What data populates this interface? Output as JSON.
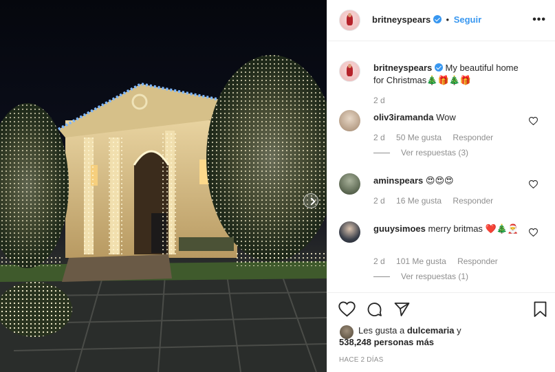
{
  "post": {
    "username": "britneyspears",
    "follow_label": "Seguir",
    "separator": "•",
    "more_label": "•••"
  },
  "caption": {
    "username": "britneyspears",
    "text": "My beautiful home for Christmas",
    "emojis": "🎄🎁🎄🎁",
    "time": "2 d"
  },
  "comments": [
    {
      "username": "oliv3iramanda",
      "text": "Wow",
      "time": "2 d",
      "likes": "50 Me gusta",
      "reply_label": "Responder",
      "view_replies": "Ver respuestas (3)"
    },
    {
      "username": "aminspears",
      "text": "😍😍😍",
      "time": "2 d",
      "likes": "16 Me gusta",
      "reply_label": "Responder"
    },
    {
      "username": "guuysimoes",
      "text": "merry britmas",
      "emojis": "❤️🎄🎅",
      "time": "2 d",
      "likes": "101 Me gusta",
      "reply_label": "Responder",
      "view_replies": "Ver respuestas (1)"
    }
  ],
  "likes_summary": {
    "prefix": "Les gusta a",
    "liker": "dulcemaria",
    "suffix": "y",
    "others": "538,248 personas más"
  },
  "posted_ago": "HACE 2 DÍAS",
  "icons": {
    "like": "heart-icon",
    "comment": "comment-icon",
    "share": "share-icon",
    "save": "bookmark-icon",
    "verified": "verified-badge-icon",
    "next": "chevron-right-icon"
  },
  "colors": {
    "link": "#3897f0",
    "muted": "#8e8e8e",
    "text": "#262626",
    "border": "#efefef"
  }
}
